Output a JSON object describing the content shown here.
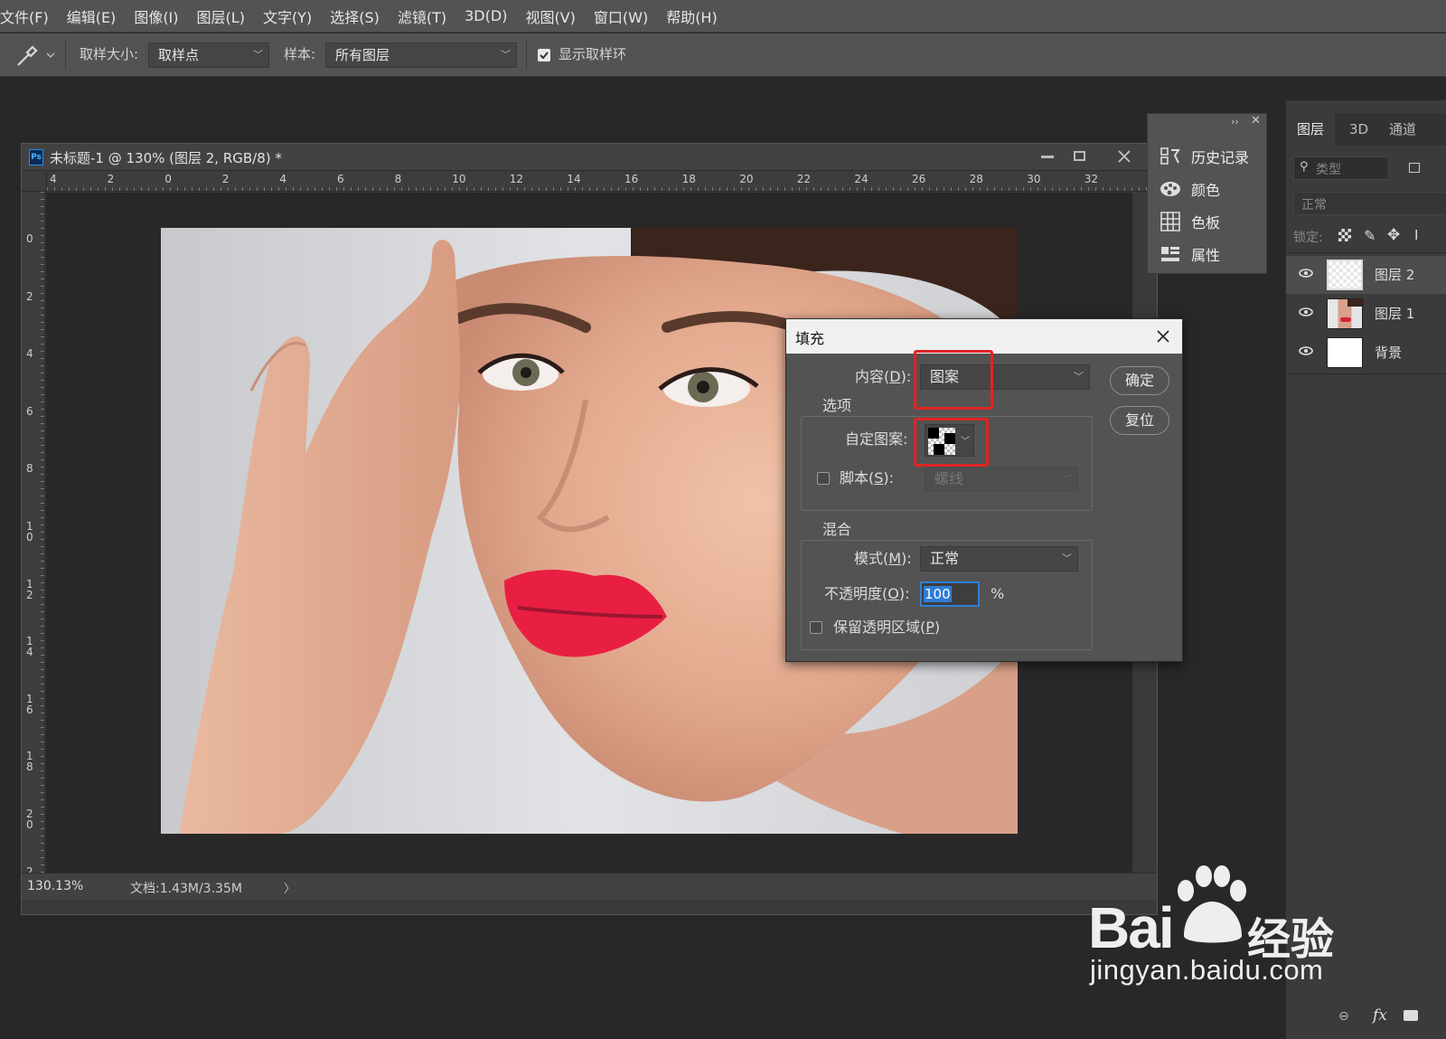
{
  "menu": [
    "文件(F)",
    "编辑(E)",
    "图像(I)",
    "图层(L)",
    "文字(Y)",
    "选择(S)",
    "滤镜(T)",
    "3D(D)",
    "视图(V)",
    "窗口(W)",
    "帮助(H)"
  ],
  "options_bar": {
    "sample_size_label": "取样大小:",
    "sample_size_value": "取样点",
    "sample_label": "样本:",
    "sample_value": "所有图层",
    "show_ring_label": "显示取样环",
    "show_ring_checked": true
  },
  "document": {
    "title": "未标题-1 @ 130% (图层 2, RGB/8) *",
    "ruler_h": [
      "4",
      "2",
      "0",
      "2",
      "4",
      "6",
      "8",
      "10",
      "12",
      "14",
      "16",
      "18",
      "20",
      "22",
      "24",
      "26",
      "28",
      "30",
      "32"
    ],
    "ruler_v": [
      "0",
      "2",
      "4",
      "6",
      "8",
      "1\n0",
      "1\n2",
      "1\n4",
      "1\n6",
      "1\n8",
      "2\n0",
      "2"
    ],
    "zoom": "130.13%",
    "doc_info": "文档:1.43M/3.35M",
    "status_arrow": "〉"
  },
  "fill_dialog": {
    "title": "填充",
    "content_label_pre": "内容(",
    "content_label_key": "D",
    "content_label_post": "):",
    "content_value": "图案",
    "options_group": "选项",
    "custom_pattern_label": "自定图案:",
    "script_label_pre": "脚本(",
    "script_label_key": "S",
    "script_label_post": "):",
    "script_value": "螺线",
    "blend_group": "混合",
    "mode_label_pre": "模式(",
    "mode_label_key": "M",
    "mode_label_post": "):",
    "mode_value": "正常",
    "opacity_label_pre": "不透明度(",
    "opacity_label_key": "O",
    "opacity_label_post": "):",
    "opacity_value": "100",
    "opacity_unit": "%",
    "preserve_label_pre": "保留透明区域(",
    "preserve_label_key": "P",
    "preserve_label_post": ")",
    "ok": "确定",
    "reset": "复位",
    "highlight_color": "#e12424"
  },
  "float_panel": {
    "items": [
      "历史记录",
      "颜色",
      "色板",
      "属性"
    ]
  },
  "layers_panel": {
    "tabs": [
      "图层",
      "3D",
      "通道"
    ],
    "search_placeholder": "类型",
    "blend_mode": "正常",
    "lock_label": "锁定:",
    "layers": [
      "图层 2",
      "图层 1",
      "背景"
    ],
    "fx": "fx"
  },
  "watermark": {
    "brand": "Bai",
    "brand_suffix": "经验",
    "url": "jingyan.baidu.com"
  }
}
